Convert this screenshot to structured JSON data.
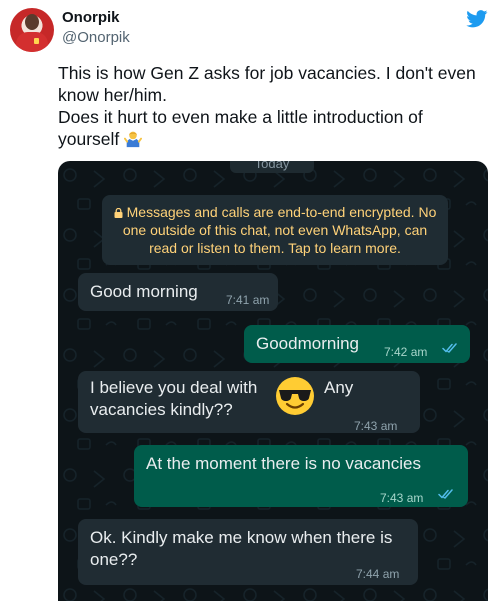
{
  "tweet": {
    "display_name": "Onorpik",
    "handle": "@Onorpik",
    "lines": [
      "This is how Gen Z asks for job vacancies. I don't even know her/him.",
      "Does it hurt to even make a little introduction of yourself"
    ],
    "emoji_icon": "person-shrugging-icon",
    "brand_color": "#1d9bf0"
  },
  "chat": {
    "date_chip": "Today",
    "encryption_notice": "Messages and calls are end-to-end encrypted. No one outside of this chat, not even WhatsApp, can read or listen to them. Tap to learn more.",
    "messages": [
      {
        "direction": "incoming",
        "text": "Good morning",
        "time": "7:41 am"
      },
      {
        "direction": "outgoing",
        "text": "Goodmorning",
        "time": "7:42 am",
        "status": "read"
      },
      {
        "direction": "incoming",
        "text": "I believe you deal with",
        "text_after_emoji": "Any",
        "text_line2": "vacancies kindly??",
        "emoji": "sunglasses-face-icon",
        "time": "7:43 am"
      },
      {
        "direction": "outgoing",
        "text": "At the moment there is no vacancies",
        "time": "7:43 am",
        "status": "read"
      },
      {
        "direction": "incoming",
        "text": "Ok. Kindly make me know when there is one??",
        "time": "7:44 am"
      }
    ],
    "colors": {
      "background": "#0d1418",
      "incoming": "#202c33",
      "outgoing": "#005c4b",
      "notice_text": "#ffd279",
      "read_ticks": "#53bdeb"
    }
  }
}
